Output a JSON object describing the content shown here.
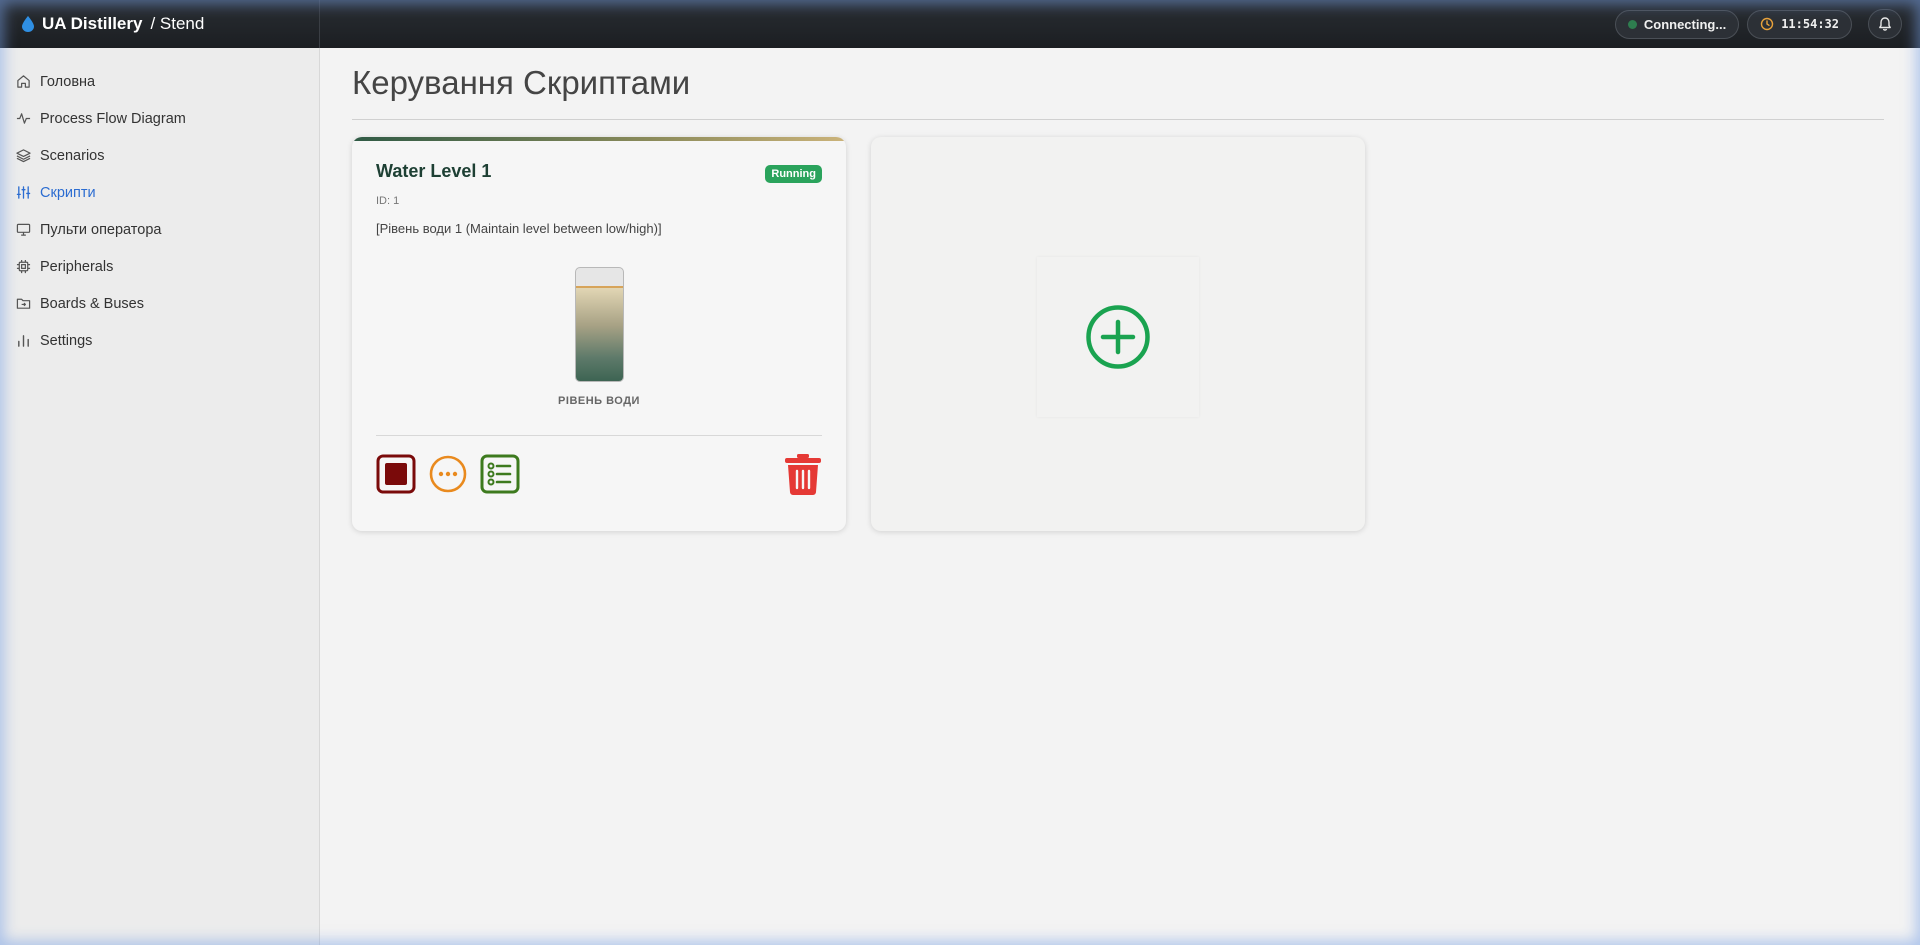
{
  "header": {
    "brand": "UA Distillery",
    "sub": "/ Stend",
    "connection_status": "Connecting...",
    "clock": "11:54:32",
    "icons": {
      "brand": "drop-icon",
      "clock": "clock-icon",
      "bell": "bell-icon"
    }
  },
  "sidebar": {
    "items": [
      {
        "label": "Головна",
        "icon": "home-icon"
      },
      {
        "label": "Process Flow Diagram",
        "icon": "activity-icon"
      },
      {
        "label": "Scenarios",
        "icon": "layers-icon"
      },
      {
        "label": "Скрипти",
        "icon": "sliders-icon",
        "active": true
      },
      {
        "label": "Пульти оператора",
        "icon": "monitor-icon"
      },
      {
        "label": "Peripherals",
        "icon": "chip-icon"
      },
      {
        "label": "Boards & Buses",
        "icon": "folder-icon"
      },
      {
        "label": "Settings",
        "icon": "bar-chart-icon"
      }
    ]
  },
  "main": {
    "title": "Керування Скриптами",
    "script_card": {
      "title": "Water Level 1",
      "status": "Running",
      "id": "ID: 1",
      "description": "[Рівень води 1 (Maintain level between low/high)]",
      "gauge_label": "РІВЕНЬ ВОДИ",
      "level_fraction": 0.84
    }
  },
  "colors": {
    "accent_active": "#2b6cd1",
    "status_running": "#2aa35c",
    "stop": "#7a0a0a",
    "more": "#e98a1e",
    "logs": "#3d7a1e",
    "delete": "#e53935",
    "add": "#1aa350"
  }
}
